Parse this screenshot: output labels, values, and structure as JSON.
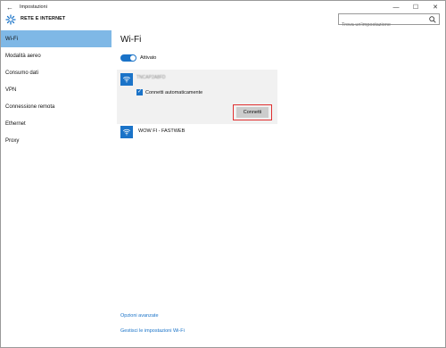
{
  "window": {
    "title": "Impostazioni",
    "back_glyph": "←",
    "minimize_glyph": "—",
    "maximize_glyph": "☐",
    "close_glyph": "✕"
  },
  "header": {
    "section_title": "RETE E INTERNET",
    "search_placeholder": "Trova un'impostazione"
  },
  "sidebar": {
    "items": [
      {
        "label": "Wi-Fi",
        "active": true
      },
      {
        "label": "Modalità aereo",
        "active": false
      },
      {
        "label": "Consumo dati",
        "active": false
      },
      {
        "label": "VPN",
        "active": false
      },
      {
        "label": "Connessione remota",
        "active": false
      },
      {
        "label": "Ethernet",
        "active": false
      },
      {
        "label": "Proxy",
        "active": false
      }
    ]
  },
  "main": {
    "title": "Wi-Fi",
    "wifi_toggle": {
      "state": "on",
      "label": "Attivato"
    },
    "networks": [
      {
        "ssid": "TNCAP2A8FD",
        "blurred": true,
        "connect_automatically": true,
        "auto_label": "Connetti automaticamente",
        "button_label": "Connetti"
      },
      {
        "ssid": "WOW FI - FASTWEB"
      }
    ],
    "links": {
      "advanced": "Opzioni avanzate",
      "manage": "Gestisci le impostazioni Wi-Fi"
    }
  },
  "colors": {
    "accent": "#1a73c8",
    "selected_nav": "#7fb8e6",
    "highlight_border": "#e03030"
  }
}
